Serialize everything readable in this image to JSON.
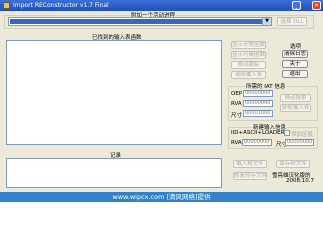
{
  "window": {
    "title": "Import REConstructor v1.7 Final"
  },
  "attach": {
    "label": "附加一个活动进程",
    "pick_dll_label": "选择 DLL"
  },
  "imports_found": {
    "label": "已找到的输入表函数"
  },
  "buttons": {
    "show_invalid": "显示无效函数",
    "show_suspect": "显示可疑函数",
    "auto_trace": "自动跟踪",
    "clear_imports": "清除输入表",
    "options": "选项",
    "clear_log": "清除日志",
    "about": "关于",
    "exit": "退出",
    "auto_search": "自动搜索",
    "get_imports": "获取输入表",
    "load_tree": "载入树文件",
    "save_tree": "保存树文件",
    "fix_dump": "修复转存文件"
  },
  "iat": {
    "label": "所需的 IAT 信息",
    "oep_label": "OEP",
    "oep_value": "00000000",
    "rva_label": "RVA",
    "rva_value": "00000000",
    "size_label": "尺寸",
    "size_value": "00001000"
  },
  "new_import": {
    "label": "新建输入信息",
    "iid_label": "IID+ASCII+LOADER",
    "add_section_label": "添加区段",
    "rva_label": "RVA",
    "rva_value": "00000000",
    "size_label": "尺寸",
    "size_value": "00000000"
  },
  "log": {
    "label": "记录"
  },
  "credits": {
    "line1": "雪亮雄汉化版的",
    "line2": "2008.10.7"
  },
  "watermark": {
    "text": "www.wipcx.com [清风网络]提供"
  },
  "colors": {
    "titlebar": "#1f4fb8",
    "window_bg": "#ece9d8",
    "selection": "#316ac5",
    "watermark_bg": "#146ec8"
  }
}
